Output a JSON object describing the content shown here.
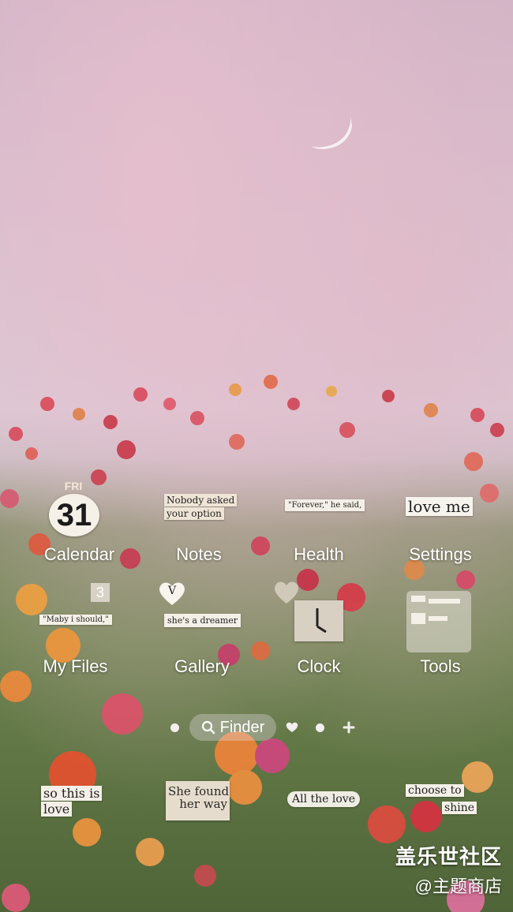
{
  "apps": {
    "calendar": {
      "day": "FRI",
      "date": "31",
      "label": "Calendar"
    },
    "notes": {
      "caption_line1": "Nobody asked",
      "caption_line2": "your option",
      "label": "Notes"
    },
    "health": {
      "caption": "\"Forever,\" he said,",
      "label": "Health"
    },
    "settings": {
      "caption": "love me",
      "label": "Settings"
    },
    "myfiles": {
      "badge": "3",
      "caption": "\"Maby i should,\"",
      "label": "My Files"
    },
    "gallery": {
      "letter": "V",
      "caption": "she's a dreamer",
      "label": "Gallery"
    },
    "clock": {
      "label": "Clock"
    },
    "tools": {
      "label": "Tools"
    }
  },
  "dock": {
    "finder_label": "Finder"
  },
  "stickers": {
    "so_this_is_1": "so this is",
    "so_this_is_2": "love",
    "she_found_1": "She found",
    "she_found_2": "her way",
    "all_the_love": "All the love",
    "choose_to": "choose to",
    "shine": "shine"
  },
  "watermark": {
    "line1": "盖乐世社区",
    "line2": "@主题商店"
  },
  "colors": {
    "sky": "#d7c3d0",
    "foliage": "#5e7443",
    "paper": "#f4f0e8"
  }
}
